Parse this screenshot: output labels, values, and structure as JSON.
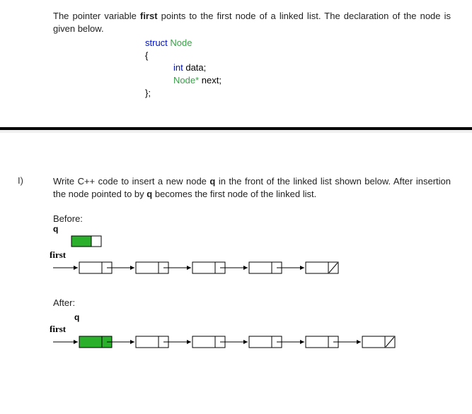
{
  "intro": {
    "text_before_bold": "The pointer variable ",
    "bold_word": "first",
    "text_after_bold": " points to the first node of a linked list. The declaration of the node is given below."
  },
  "code": {
    "line1_kw": "struct",
    "line1_ident": " Node",
    "line2": "{",
    "line3_kw": "int",
    "line3_rest": " data;",
    "line4_ident": "Node*",
    "line4_rest": " next;",
    "line5": "};"
  },
  "question": {
    "label": "I)",
    "text_part1": "Write C++ code to insert a new node ",
    "bold_q1": "q",
    "text_part2": " in the front of the linked list shown below. After insertion the node pointed to by ",
    "bold_q2": "q",
    "text_part3": " becomes the first node of the linked list."
  },
  "labels": {
    "before": "Before:",
    "after": "After:",
    "q": "q",
    "first": "first"
  }
}
